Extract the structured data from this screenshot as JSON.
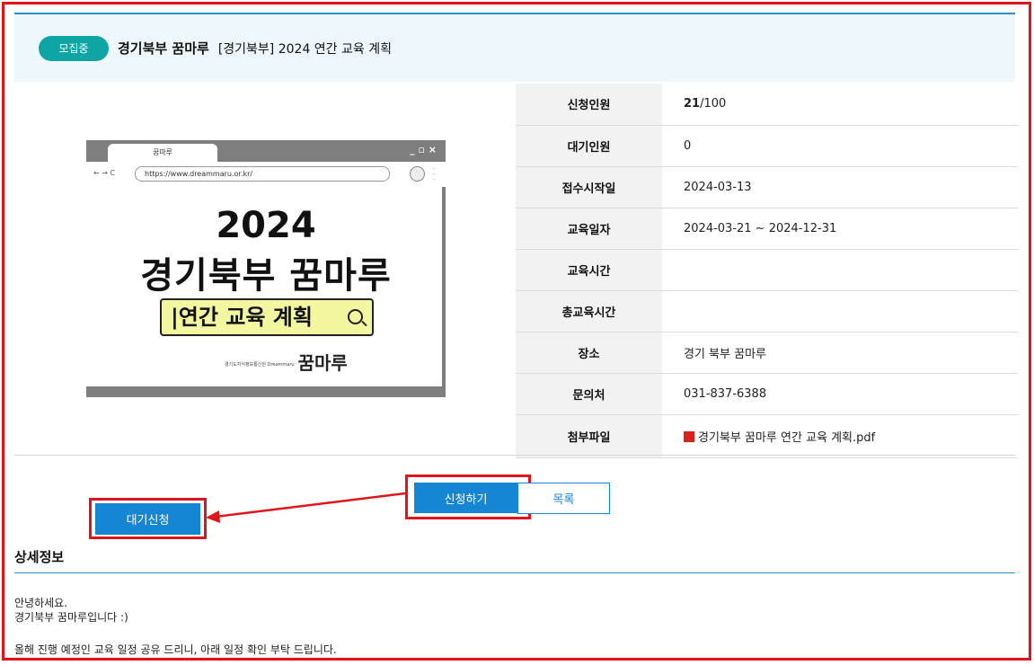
{
  "header": {
    "status_badge": "모집중",
    "org": "경기북부 꿈마루",
    "title": "[경기북부] 2024 연간 교육 계획"
  },
  "thumbnail": {
    "tab_label": "꿈마루",
    "window_controls": "_ ▫ ×",
    "nav": "← → C",
    "address": "https://www.dreammaru.or.kr/",
    "year": "2024",
    "name": "경기북부 꿈마루",
    "search_text": "|연간 교육 계획",
    "logo_small": "경기도지식정보통신원 Dreammaru",
    "logo": "꿈마루"
  },
  "info": [
    {
      "label": "신청인원",
      "value_bold": "21",
      "value": "/100"
    },
    {
      "label": "대기인원",
      "value_bold": "",
      "value": "0"
    },
    {
      "label": "접수시작일",
      "value_bold": "",
      "value": "2024-03-13"
    },
    {
      "label": "교육일자",
      "value_bold": "",
      "value": "2024-03-21 ~ 2024-12-31"
    },
    {
      "label": "교육시간",
      "value_bold": "",
      "value": ""
    },
    {
      "label": "총교육시간",
      "value_bold": "",
      "value": ""
    },
    {
      "label": "장소",
      "value_bold": "",
      "value": "경기 북부 꿈마루"
    },
    {
      "label": "문의처",
      "value_bold": "",
      "value": "031-837-6388"
    },
    {
      "label": "첨부파일",
      "value_bold": "",
      "value": "경기북부 꿈마루 연간 교육 계획.pdf"
    }
  ],
  "buttons": {
    "apply": "신청하기",
    "list": "목록",
    "waitlist": "대기신청"
  },
  "detail": {
    "title": "상세정보",
    "line1": "안녕하세요.",
    "line2": "경기북부 꿈마루입니다 :)",
    "line3": "올해 진행 예정인 교육 일정 공유 드리니, 아래 일정 확인 부탁 드립니다."
  },
  "colors": {
    "highlight": "#e0151a",
    "primary": "#1486d4",
    "badge": "#10a5a5"
  }
}
